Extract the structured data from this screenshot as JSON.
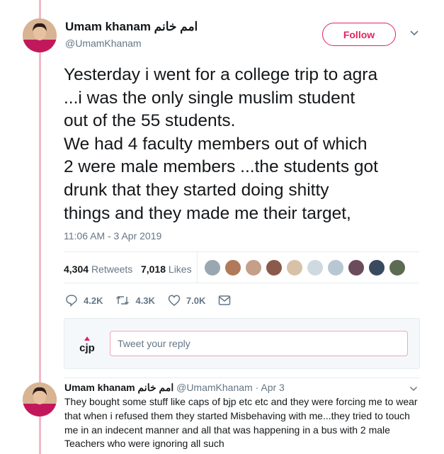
{
  "tweet": {
    "author_name": "Umam khanam امم خانم",
    "handle": "@UmamKhanam",
    "follow_label": "Follow",
    "text_lines": [
      "Yesterday i went for a college trip to agra",
      "...i was the only single muslim student",
      "out of the 55 students.",
      "We had 4 faculty members out of which",
      "2 were male members ...the students got",
      "drunk that they started doing shitty",
      "things and they made me their target,"
    ],
    "timestamp": "11:06 AM - 3 Apr 2019",
    "retweets_count": "4,304",
    "retweets_label": "Retweets",
    "likes_count": "7,018",
    "likes_label": "Likes",
    "actions": {
      "reply_count": "4.2K",
      "retweet_count": "4.3K",
      "like_count": "7.0K"
    }
  },
  "reply_box": {
    "placeholder": "Tweet your reply",
    "logo_text": "cjp"
  },
  "reply": {
    "author_name": "Umam khanam امم خانم",
    "meta": "@UmamKhanam · Apr 3",
    "text_lines": [
      "They bought some stuff like caps of bjp etc etc and they were forcing me to wear",
      "that when i refused them they started  Misbehaving with me...they tried to touch",
      "me in an indecent manner and all that was happening in a bus with 2 male",
      "Teachers who were ignoring all such"
    ]
  },
  "colors": {
    "accent": "#e0245e",
    "thread_line": "#f2b8c6",
    "muted": "#657786",
    "liker_avatars": [
      "#9aa7b0",
      "#b07a5a",
      "#c4a089",
      "#8a5a4a",
      "#d7c2a8",
      "#cfd9e0",
      "#b8c7d2",
      "#6b4c5c",
      "#3a4a5e",
      "#5d6b52"
    ]
  },
  "icons": [
    "caret-down-icon",
    "reply-icon",
    "retweet-icon",
    "heart-icon",
    "message-icon",
    "cjp-logo-icon"
  ]
}
